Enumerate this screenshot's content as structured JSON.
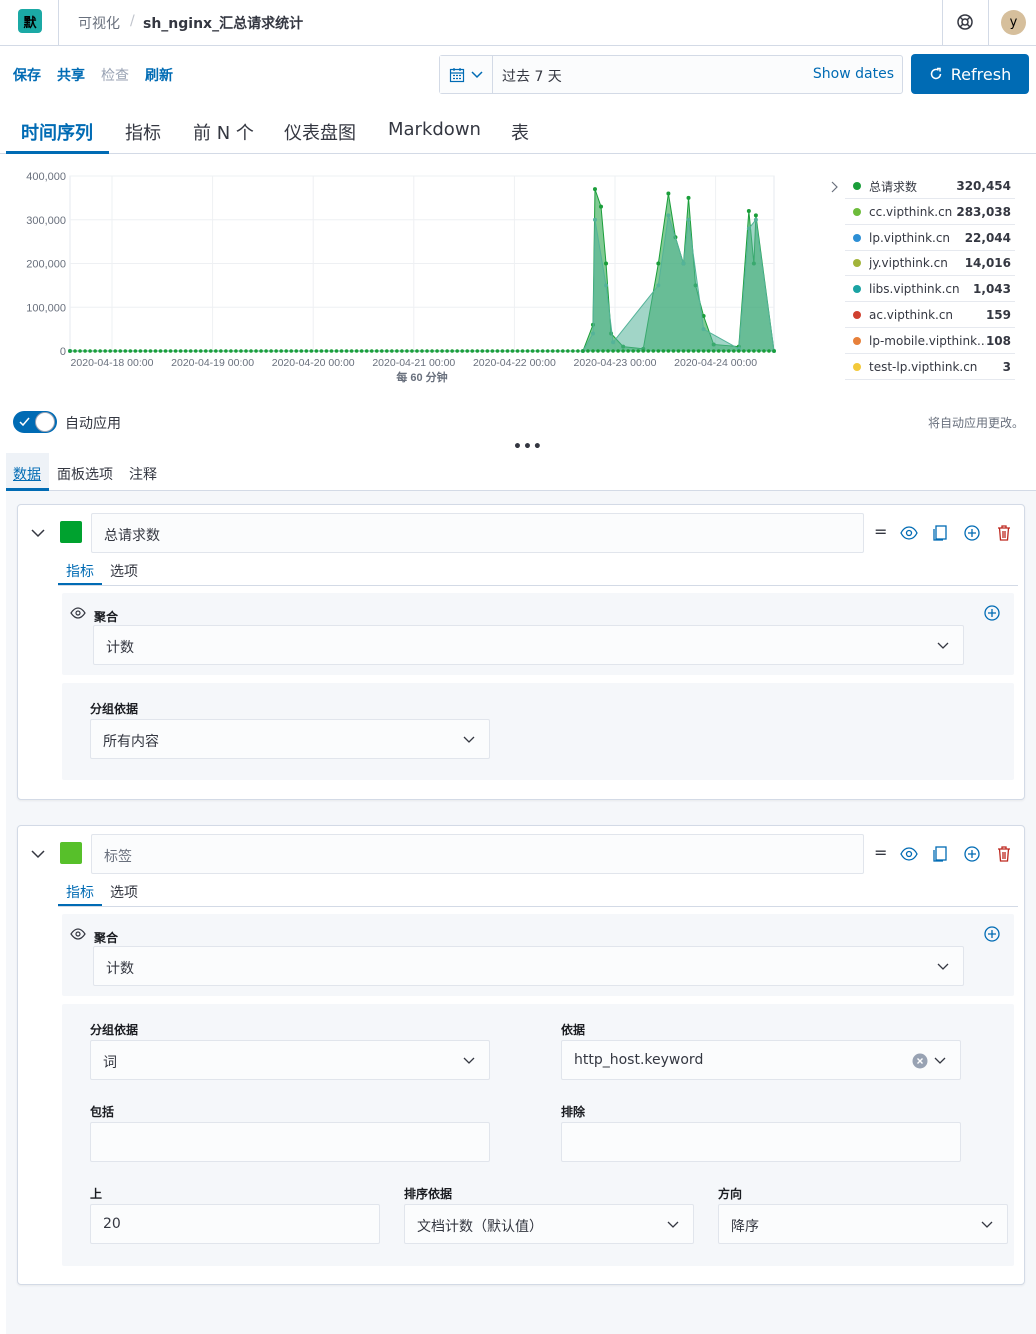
{
  "header": {
    "logo_letter": "默",
    "breadcrumb_parent": "可视化",
    "breadcrumb_current": "sh_nginx_汇总请求统计",
    "avatar": "y"
  },
  "actions": {
    "save": "保存",
    "share": "共享",
    "inspect": "检查",
    "refresh_link": "刷新",
    "date_range": "过去 7 天",
    "show_dates": "Show dates",
    "refresh_button": "Refresh"
  },
  "tabs": [
    "时间序列",
    "指标",
    "前 N 个",
    "仪表盘图",
    "Markdown",
    "表"
  ],
  "chart_data": {
    "type": "area",
    "x_ticks": [
      "2020-04-18 00:00",
      "2020-04-19 00:00",
      "2020-04-20 00:00",
      "2020-04-21 00:00",
      "2020-04-22 00:00",
      "2020-04-23 00:00",
      "2020-04-24 00:00"
    ],
    "y_ticks": [
      "400,000",
      "300,000",
      "200,000",
      "100,000",
      "0"
    ],
    "ylim": [
      0,
      400000
    ],
    "xlabel": "每 60 分钟",
    "series": [
      {
        "name": "总请求数",
        "color": "#1a9e3a",
        "points": [
          [
            0,
            0
          ],
          [
            5.1,
            0
          ],
          [
            5.2,
            60000
          ],
          [
            5.22,
            370000
          ],
          [
            5.28,
            330000
          ],
          [
            5.33,
            200000
          ],
          [
            5.38,
            40000
          ],
          [
            5.5,
            10000
          ],
          [
            5.7,
            5000
          ],
          [
            5.85,
            200000
          ],
          [
            5.95,
            360000
          ],
          [
            6.02,
            260000
          ],
          [
            6.1,
            200000
          ],
          [
            6.15,
            350000
          ],
          [
            6.22,
            150000
          ],
          [
            6.3,
            80000
          ],
          [
            6.4,
            15000
          ],
          [
            6.65,
            10000
          ],
          [
            6.75,
            320000
          ],
          [
            6.8,
            200000
          ],
          [
            6.82,
            310000
          ],
          [
            7.0,
            0
          ]
        ]
      },
      {
        "name": "cc.vipthink.cn",
        "color": "#54b399",
        "points": [
          [
            0,
            0
          ],
          [
            5.1,
            0
          ],
          [
            5.2,
            40000
          ],
          [
            5.22,
            300000
          ],
          [
            5.33,
            150000
          ],
          [
            5.4,
            20000
          ],
          [
            5.85,
            150000
          ],
          [
            5.95,
            310000
          ],
          [
            6.1,
            200000
          ],
          [
            6.15,
            300000
          ],
          [
            6.3,
            50000
          ],
          [
            6.65,
            5000
          ],
          [
            6.75,
            280000
          ],
          [
            6.82,
            300000
          ],
          [
            7.0,
            0
          ]
        ]
      }
    ]
  },
  "legend": [
    {
      "name": "总请求数",
      "value": "320,454",
      "color": "#1a9e3a"
    },
    {
      "name": "cc.vipthink.cn",
      "value": "283,038",
      "color": "#6dbc3b"
    },
    {
      "name": "lp.vipthink.cn",
      "value": "22,044",
      "color": "#2d8fd5"
    },
    {
      "name": "jy.vipthink.cn",
      "value": "14,016",
      "color": "#a2b43a"
    },
    {
      "name": "libs.vipthink.cn",
      "value": "1,043",
      "color": "#1aa3a3"
    },
    {
      "name": "ac.vipthink.cn",
      "value": "159",
      "color": "#d0402f"
    },
    {
      "name": "lp-mobile.vipthink....",
      "value": "108",
      "color": "#e7803a"
    },
    {
      "name": "test-lp.vipthink.cn",
      "value": "3",
      "color": "#f3c93a"
    }
  ],
  "editor": {
    "auto_apply_label": "自动应用",
    "auto_apply_note": "将自动应用更改。",
    "tabs": [
      "数据",
      "面板选项",
      "注释"
    ]
  },
  "series1": {
    "color": "#00a22f",
    "label": "总请求数",
    "subtabs": [
      "指标",
      "选项"
    ],
    "agg_label": "聚合",
    "agg_value": "计数",
    "group_label": "分组依据",
    "group_value": "所有内容"
  },
  "series2": {
    "color": "#57c02a",
    "label_placeholder": "标签",
    "subtabs": [
      "指标",
      "选项"
    ],
    "agg_label": "聚合",
    "agg_value": "计数",
    "group_label": "分组依据",
    "group_value": "词",
    "by_label": "依据",
    "by_value": "http_host.keyword",
    "include_label": "包括",
    "exclude_label": "排除",
    "top_label": "上",
    "top_value": "20",
    "order_by_label": "排序依据",
    "order_by_value": "文档计数（默认值）",
    "direction_label": "方向",
    "direction_value": "降序"
  }
}
